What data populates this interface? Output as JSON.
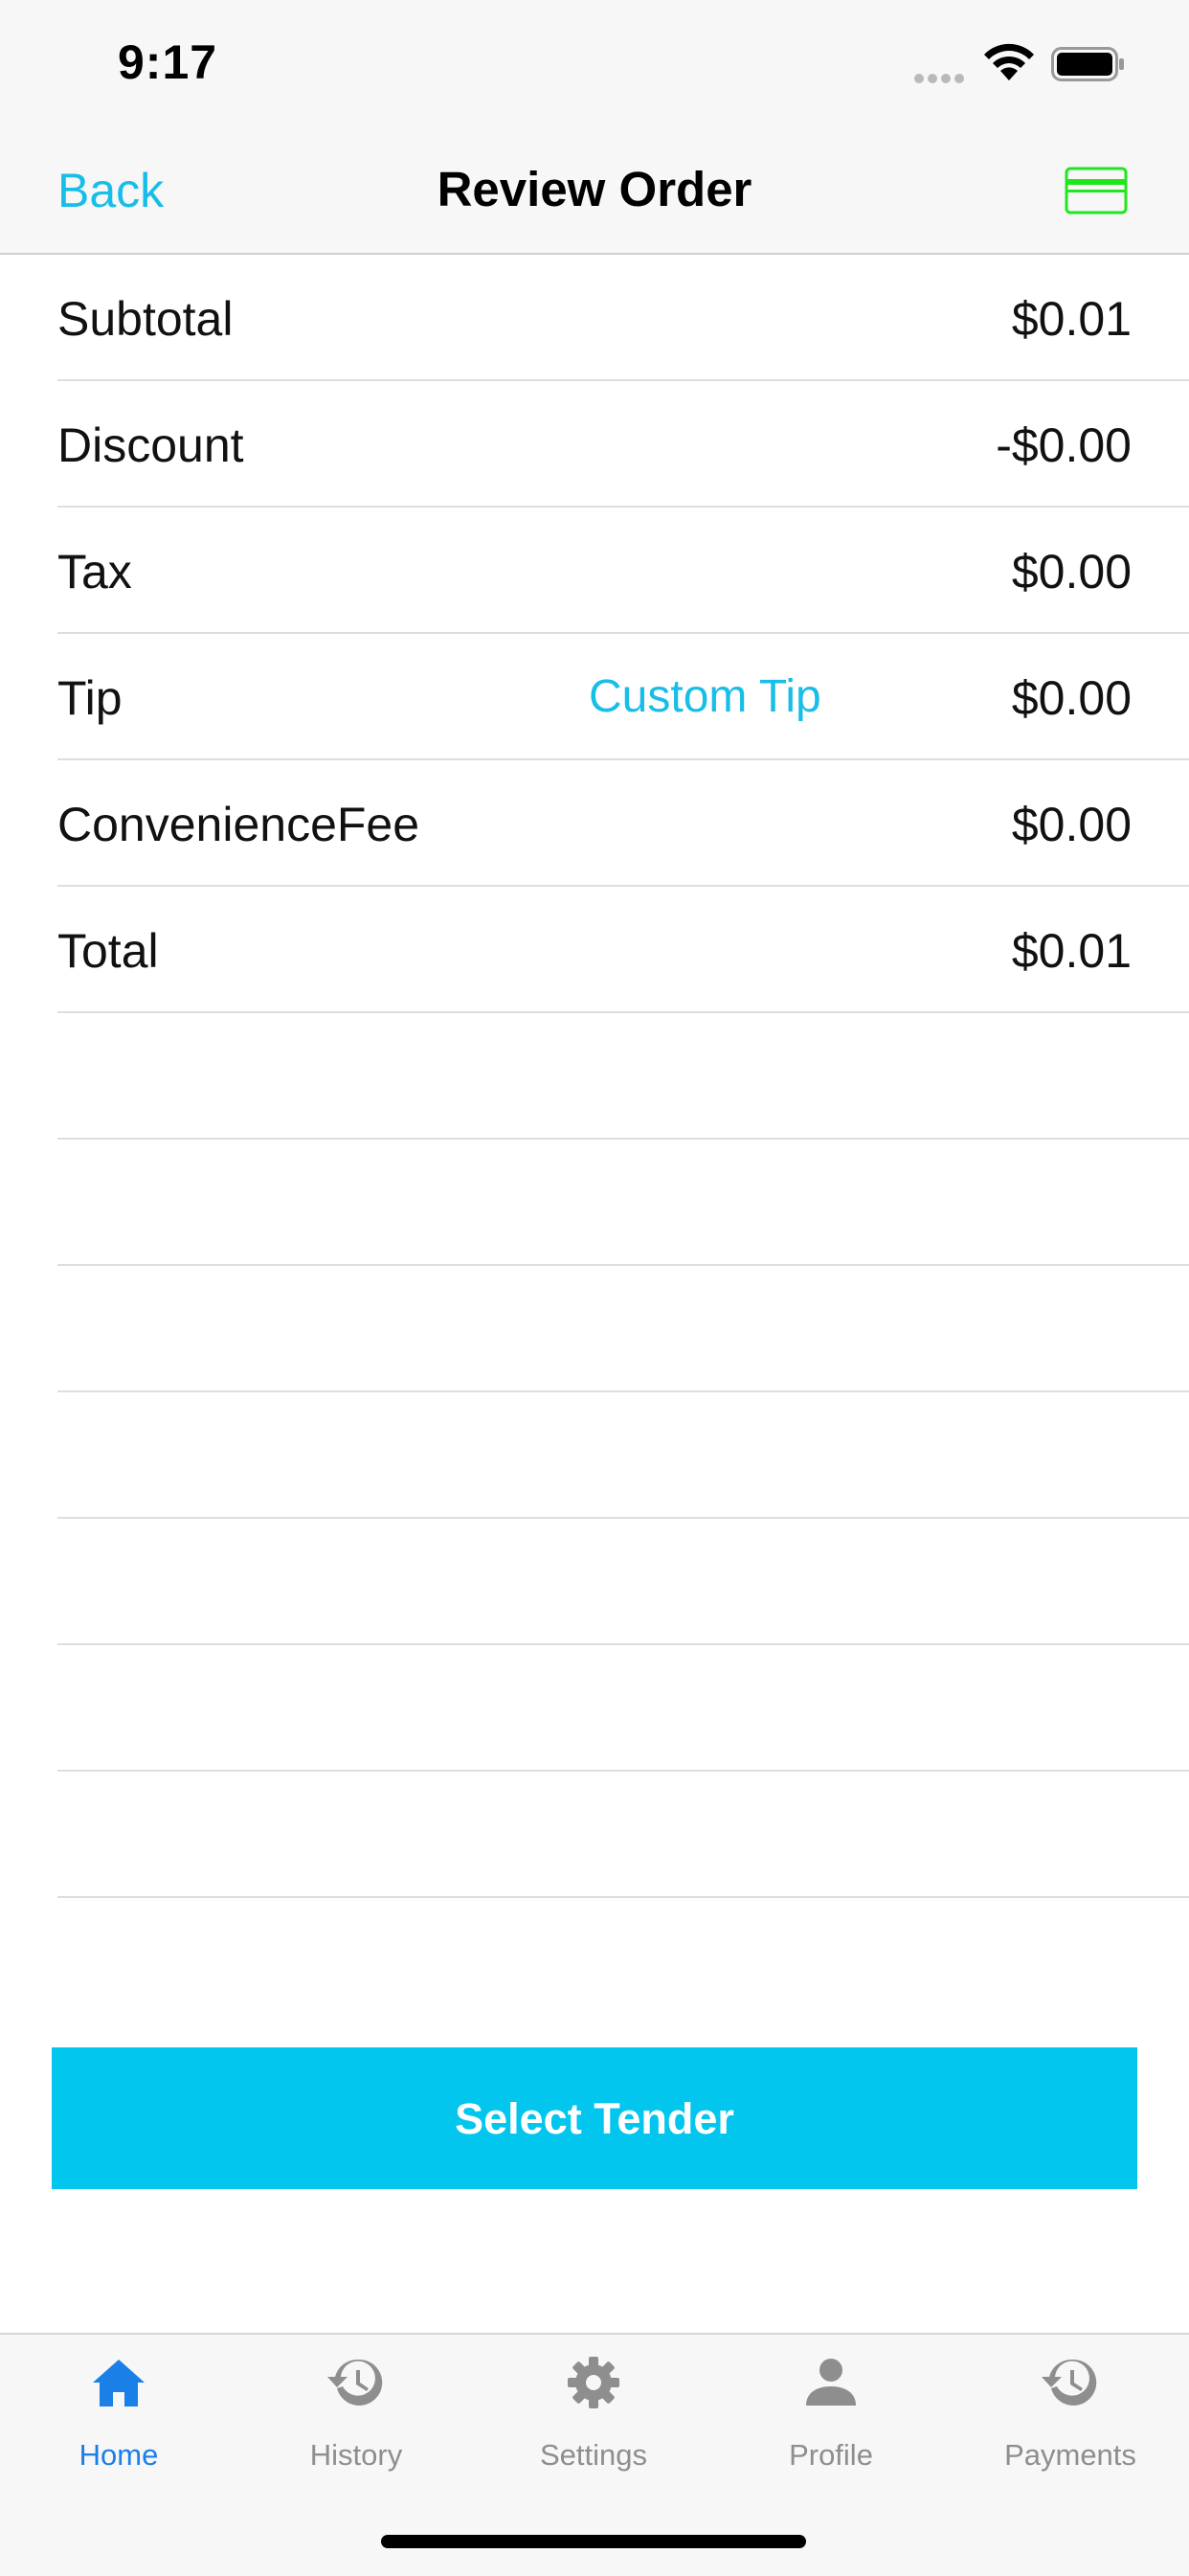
{
  "status_bar": {
    "time": "9:17"
  },
  "nav": {
    "back_label": "Back",
    "title": "Review Order",
    "right_icon": "credit-card-icon",
    "right_icon_color": "#22e61d"
  },
  "rows": [
    {
      "label": "Subtotal",
      "value": "$0.01"
    },
    {
      "label": "Discount",
      "value": "-$0.00"
    },
    {
      "label": "Tax",
      "value": "$0.00"
    },
    {
      "label": "Tip",
      "action": "Custom Tip",
      "value": "$0.00"
    },
    {
      "label": "ConvenienceFee",
      "value": "$0.00"
    },
    {
      "label": "Total",
      "value": "$0.01"
    }
  ],
  "primary_button": {
    "label": "Select Tender",
    "color": "#03c6ef"
  },
  "tab_bar": {
    "active_color": "#1b7fe8",
    "inactive_color": "#8e8e8e",
    "tabs": [
      {
        "label": "Home",
        "icon": "home-icon",
        "active": true
      },
      {
        "label": "History",
        "icon": "history-icon",
        "active": false
      },
      {
        "label": "Settings",
        "icon": "gear-icon",
        "active": false
      },
      {
        "label": "Profile",
        "icon": "person-icon",
        "active": false
      },
      {
        "label": "Payments",
        "icon": "history-icon",
        "active": false
      }
    ]
  },
  "colors": {
    "accent": "#18bde8",
    "bar_background": "#f7f7f7",
    "separator": "#dedede"
  }
}
